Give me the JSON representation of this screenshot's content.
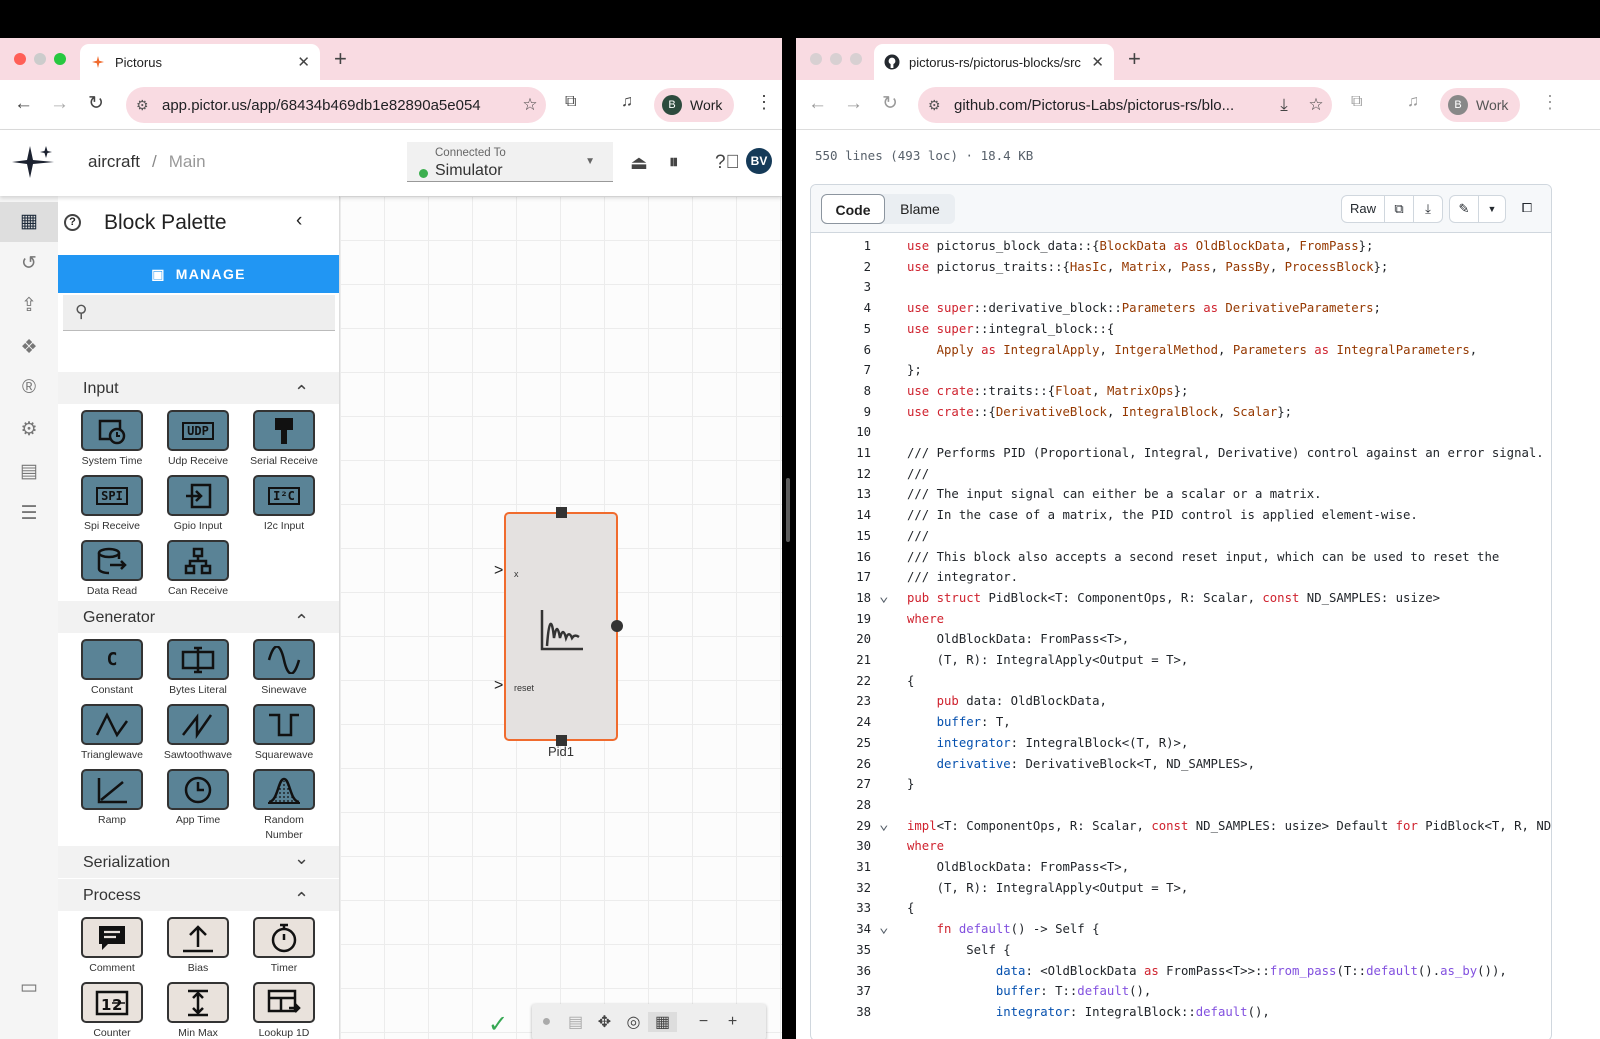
{
  "left": {
    "tab_title": "Pictorus",
    "url": "app.pictor.us/app/68434b469db1e82890a5e054",
    "profile": {
      "initial": "B",
      "label": "Work"
    },
    "app": {
      "breadcrumb_project": "aircraft",
      "breadcrumb_sep": "/",
      "breadcrumb_diagram": "Main",
      "connection_label": "Connected To",
      "connection_value": "Simulator",
      "connection_status_color": "#3caf4f",
      "user_initials": "BV"
    },
    "palette": {
      "title": "Block Palette",
      "manage_label": "MANAGE",
      "search_placeholder": "",
      "sections": [
        {
          "title": "Input",
          "expanded": true,
          "blocks": [
            {
              "label": "System Time",
              "icon": "clock-calendar-icon",
              "color": "blue"
            },
            {
              "label": "Udp Receive",
              "icon": "UDP",
              "color": "blue"
            },
            {
              "label": "Serial Receive",
              "icon": "serial-plug-icon",
              "color": "blue"
            },
            {
              "label": "Spi Receive",
              "icon": "SPI",
              "color": "blue"
            },
            {
              "label": "Gpio Input",
              "icon": "gpio-input-icon",
              "color": "blue"
            },
            {
              "label": "I2c Input",
              "icon": "I²C",
              "color": "blue"
            },
            {
              "label": "Data Read",
              "icon": "database-read-icon",
              "color": "blue"
            },
            {
              "label": "Can Receive",
              "icon": "network-tree-icon",
              "color": "blue"
            }
          ]
        },
        {
          "title": "Generator",
          "expanded": true,
          "blocks": [
            {
              "label": "Constant",
              "icon": "C",
              "color": "blue"
            },
            {
              "label": "Bytes Literal",
              "icon": "text-cursor-icon",
              "color": "blue"
            },
            {
              "label": "Sinewave",
              "icon": "sine-icon",
              "color": "blue"
            },
            {
              "label": "Trianglewave",
              "icon": "triangle-wave-icon",
              "color": "blue"
            },
            {
              "label": "Sawtoothwave",
              "icon": "sawtooth-icon",
              "color": "blue"
            },
            {
              "label": "Squarewave",
              "icon": "square-wave-icon",
              "color": "blue"
            },
            {
              "label": "Ramp",
              "icon": "ramp-icon",
              "color": "blue"
            },
            {
              "label": "App Time",
              "icon": "clock-icon",
              "color": "blue"
            },
            {
              "label": "Random Number",
              "icon": "bell-curve-icon",
              "color": "blue"
            }
          ]
        },
        {
          "title": "Serialization",
          "expanded": false,
          "blocks": []
        },
        {
          "title": "Process",
          "expanded": true,
          "blocks": [
            {
              "label": "Comment",
              "icon": "comment-icon",
              "color": "beige"
            },
            {
              "label": "Bias",
              "icon": "bias-arrow-icon",
              "color": "beige"
            },
            {
              "label": "Timer",
              "icon": "stopwatch-icon",
              "color": "beige"
            },
            {
              "label": "Counter",
              "icon": "counter-icon",
              "color": "beige"
            },
            {
              "label": "Min Max",
              "icon": "min-max-icon",
              "color": "beige"
            },
            {
              "label": "Lookup 1D",
              "icon": "lookup-table-icon",
              "color": "beige"
            }
          ]
        }
      ]
    },
    "canvas": {
      "block_name": "Pid1",
      "input_x": "x",
      "input_reset": "reset",
      "block_border_color": "#f06b2e"
    }
  },
  "right": {
    "tab_title": "pictorus-rs/pictorus-blocks/src",
    "url": "github.com/Pictorus-Labs/pictorus-rs/blo...",
    "profile": {
      "initial": "B",
      "label": "Work"
    },
    "file_info": "550 lines (493 loc) · 18.4 KB",
    "tabs": {
      "code": "Code",
      "blame": "Blame"
    },
    "raw_label": "Raw",
    "lines": [
      "use pictorus_block_data::{BlockData as OldBlockData, FromPass};",
      "use pictorus_traits::{HasIc, Matrix, Pass, PassBy, ProcessBlock};",
      "",
      "use super::derivative_block::Parameters as DerivativeParameters;",
      "use super::integral_block::{",
      "    Apply as IntegralApply, IntgeralMethod, Parameters as IntegralParameters,",
      "};",
      "use crate::traits::{Float, MatrixOps};",
      "use crate::{DerivativeBlock, IntegralBlock, Scalar};",
      "",
      "/// Performs PID (Proportional, Integral, Derivative) control against an error signal.",
      "///",
      "/// The input signal can either be a scalar or a matrix.",
      "/// In the case of a matrix, the PID control is applied element-wise.",
      "///",
      "/// This block also accepts a second reset input, which can be used to reset the",
      "/// integrator.",
      "pub struct PidBlock<T: ComponentOps, R: Scalar, const ND_SAMPLES: usize>",
      "where",
      "    OldBlockData: FromPass<T>,",
      "    (T, R): IntegralApply<Output = T>,",
      "{",
      "    pub data: OldBlockData,",
      "    buffer: T,",
      "    integrator: IntegralBlock<(T, R)>,",
      "    derivative: DerivativeBlock<T, ND_SAMPLES>,",
      "}",
      "",
      "impl<T: ComponentOps, R: Scalar, const ND_SAMPLES: usize> Default for PidBlock<T, R, ND_SAMPLES>",
      "where",
      "    OldBlockData: FromPass<T>,",
      "    (T, R): IntegralApply<Output = T>,",
      "{",
      "    fn default() -> Self {",
      "        Self {",
      "            data: <OldBlockData as FromPass<T>>::from_pass(T::default().as_by()),",
      "            buffer: T::default(),",
      "            integrator: IntegralBlock::default(),"
    ],
    "folded_lines": [
      18,
      29,
      34
    ]
  }
}
